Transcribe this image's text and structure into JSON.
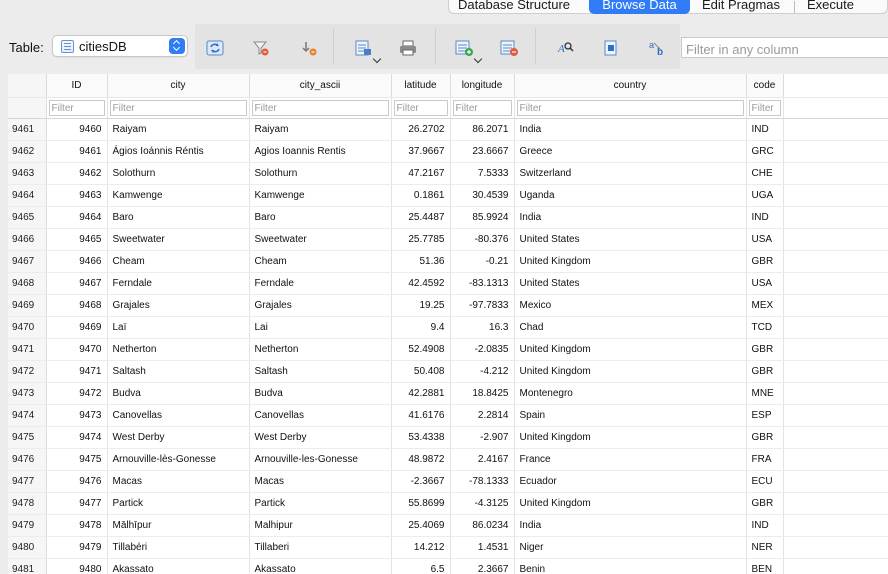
{
  "tabs": [
    {
      "label": "Database Structure",
      "active": false
    },
    {
      "label": "Browse Data",
      "active": true
    },
    {
      "label": "Edit Pragmas",
      "active": false
    },
    {
      "label": "Execute SQL",
      "active": false
    }
  ],
  "toolbar": {
    "table_label": "Table:",
    "table_value": "citiesDB",
    "filter_placeholder": "Filter in any column",
    "buttons": [
      "refresh-icon",
      "clear-filters-icon",
      "clear-sorting-icon",
      "save-table-icon",
      "print-icon",
      "insert-record-icon",
      "delete-record-icon",
      "find-icon",
      "find-replace-icon",
      "text-format-icon"
    ]
  },
  "grid": {
    "columns": [
      "ID",
      "city",
      "city_ascii",
      "latitude",
      "longitude",
      "country",
      "code"
    ],
    "filter_placeholder": "Filter",
    "rows": [
      {
        "rn": "9461",
        "id": "9460",
        "city": "Raiyam",
        "ascii": "Raiyam",
        "lat": "26.2702",
        "lng": "86.2071",
        "country": "India",
        "code": "IND"
      },
      {
        "rn": "9462",
        "id": "9461",
        "city": "Ágios Ioánnis Réntis",
        "ascii": "Agios Ioannis Rentis",
        "lat": "37.9667",
        "lng": "23.6667",
        "country": "Greece",
        "code": "GRC"
      },
      {
        "rn": "9463",
        "id": "9462",
        "city": "Solothurn",
        "ascii": "Solothurn",
        "lat": "47.2167",
        "lng": "7.5333",
        "country": "Switzerland",
        "code": "CHE"
      },
      {
        "rn": "9464",
        "id": "9463",
        "city": "Kamwenge",
        "ascii": "Kamwenge",
        "lat": "0.1861",
        "lng": "30.4539",
        "country": "Uganda",
        "code": "UGA"
      },
      {
        "rn": "9465",
        "id": "9464",
        "city": "Baro",
        "ascii": "Baro",
        "lat": "25.4487",
        "lng": "85.9924",
        "country": "India",
        "code": "IND"
      },
      {
        "rn": "9466",
        "id": "9465",
        "city": "Sweetwater",
        "ascii": "Sweetwater",
        "lat": "25.7785",
        "lng": "-80.376",
        "country": "United States",
        "code": "USA"
      },
      {
        "rn": "9467",
        "id": "9466",
        "city": "Cheam",
        "ascii": "Cheam",
        "lat": "51.36",
        "lng": "-0.21",
        "country": "United Kingdom",
        "code": "GBR"
      },
      {
        "rn": "9468",
        "id": "9467",
        "city": "Ferndale",
        "ascii": "Ferndale",
        "lat": "42.4592",
        "lng": "-83.1313",
        "country": "United States",
        "code": "USA"
      },
      {
        "rn": "9469",
        "id": "9468",
        "city": "Grajales",
        "ascii": "Grajales",
        "lat": "19.25",
        "lng": "-97.7833",
        "country": "Mexico",
        "code": "MEX"
      },
      {
        "rn": "9470",
        "id": "9469",
        "city": "Laï",
        "ascii": "Lai",
        "lat": "9.4",
        "lng": "16.3",
        "country": "Chad",
        "code": "TCD"
      },
      {
        "rn": "9471",
        "id": "9470",
        "city": "Netherton",
        "ascii": "Netherton",
        "lat": "52.4908",
        "lng": "-2.0835",
        "country": "United Kingdom",
        "code": "GBR"
      },
      {
        "rn": "9472",
        "id": "9471",
        "city": "Saltash",
        "ascii": "Saltash",
        "lat": "50.408",
        "lng": "-4.212",
        "country": "United Kingdom",
        "code": "GBR"
      },
      {
        "rn": "9473",
        "id": "9472",
        "city": "Budva",
        "ascii": "Budva",
        "lat": "42.2881",
        "lng": "18.8425",
        "country": "Montenegro",
        "code": "MNE"
      },
      {
        "rn": "9474",
        "id": "9473",
        "city": "Canovellas",
        "ascii": "Canovellas",
        "lat": "41.6176",
        "lng": "2.2814",
        "country": "Spain",
        "code": "ESP"
      },
      {
        "rn": "9475",
        "id": "9474",
        "city": "West Derby",
        "ascii": "West Derby",
        "lat": "53.4338",
        "lng": "-2.907",
        "country": "United Kingdom",
        "code": "GBR"
      },
      {
        "rn": "9476",
        "id": "9475",
        "city": "Arnouville-lès-Gonesse",
        "ascii": "Arnouville-les-Gonesse",
        "lat": "48.9872",
        "lng": "2.4167",
        "country": "France",
        "code": "FRA"
      },
      {
        "rn": "9477",
        "id": "9476",
        "city": "Macas",
        "ascii": "Macas",
        "lat": "-2.3667",
        "lng": "-78.1333",
        "country": "Ecuador",
        "code": "ECU"
      },
      {
        "rn": "9478",
        "id": "9477",
        "city": "Partick",
        "ascii": "Partick",
        "lat": "55.8699",
        "lng": "-4.3125",
        "country": "United Kingdom",
        "code": "GBR"
      },
      {
        "rn": "9479",
        "id": "9478",
        "city": "Mālhīpur",
        "ascii": "Malhipur",
        "lat": "25.4069",
        "lng": "86.0234",
        "country": "India",
        "code": "IND"
      },
      {
        "rn": "9480",
        "id": "9479",
        "city": "Tillabéri",
        "ascii": "Tillaberi",
        "lat": "14.212",
        "lng": "1.4531",
        "country": "Niger",
        "code": "NER"
      },
      {
        "rn": "9481",
        "id": "9480",
        "city": "Akassato",
        "ascii": "Akassato",
        "lat": "6.5",
        "lng": "2.3667",
        "country": "Benin",
        "code": "BEN"
      }
    ]
  },
  "colors": {
    "accent": "#2f7cf6",
    "background": "#ececec",
    "grid_background": "#ffffff"
  }
}
